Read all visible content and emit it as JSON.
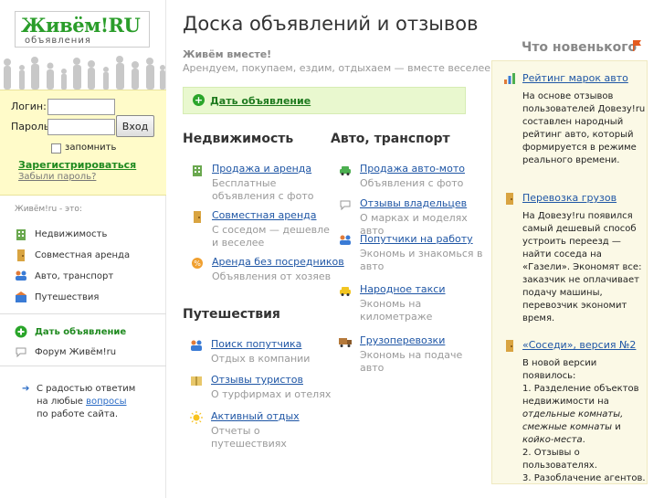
{
  "logo": {
    "main": "Живём!",
    "ru": "RU",
    "sub": "объявления"
  },
  "login": {
    "login_label": "Логин:",
    "password_label": "Пароль:",
    "enter_button": "Вход",
    "remember_label": "запомнить",
    "register_link": "Зарегистрироваться",
    "forgot_link": "Забыли пароль?"
  },
  "about": {
    "title": "Живём!ru - это:",
    "items": [
      {
        "label": "Недвижимость",
        "icon": "building-icon"
      },
      {
        "label": "Совместная аренда",
        "icon": "door-icon"
      },
      {
        "label": "Авто, транспорт",
        "icon": "people-car-icon"
      },
      {
        "label": "Путешествия",
        "icon": "travel-icon"
      }
    ],
    "post_label": "Дать объявление",
    "forum_label": "Форум Живём!ru"
  },
  "help": {
    "line1": "С радостью ответим",
    "line2_pre": "на любые ",
    "line2_link": "вопросы",
    "line3": "по работе сайта."
  },
  "main": {
    "title": "Доска объявлений и отзывов",
    "tagline1": "Живём вместе!",
    "tagline2": "Арендуем, покупаем, ездим, отдыхаем — вместе веселее!",
    "post_button": "Дать объявление"
  },
  "sections": {
    "realty": {
      "title": "Недвижимость",
      "entries": [
        {
          "link": "Продажа и аренда",
          "desc": "Бесплатные объявления с фото"
        },
        {
          "link": "Совместная аренда",
          "desc": "С соседом — дешевле и веселее"
        },
        {
          "link": "Аренда без посредников",
          "desc": "Объявления от хозяев"
        }
      ]
    },
    "auto": {
      "title": "Авто, транспорт",
      "entries": [
        {
          "link": "Продажа авто-мото",
          "desc": "Объявления с фото"
        },
        {
          "link": "Отзывы владельцев",
          "desc": "О марках и моделях авто"
        },
        {
          "link": "Попутчики на работу",
          "desc": "Экономь и знакомься в авто"
        },
        {
          "link": "Народное такси",
          "desc": "Экономь на километраже"
        },
        {
          "link": "Грузоперевозки",
          "desc": "Экономь на подаче авто"
        }
      ]
    },
    "travel": {
      "title": "Путешествия",
      "entries": [
        {
          "link": "Поиск попутчика",
          "desc": "Отдых в компании"
        },
        {
          "link": "Отзывы туристов",
          "desc": "О турфирмах и отелях"
        },
        {
          "link": "Активный отдых",
          "desc": "Отчеты о путешествиях"
        }
      ]
    }
  },
  "news": {
    "title": "Что новенького",
    "items": [
      {
        "link": "Рейтинг марок авто",
        "body": "На основе отзывов пользователей Довезу!ru составлен народный рейтинг авто, который формируется в режиме реального времени."
      },
      {
        "link": "Перевозка грузов",
        "body": "На Довезу!ru появился самый дешевый способ устроить переезд — найти соседа на «Газели». Экономят все: заказчик не оплачивает подачу машины, перевозчик экономит время."
      },
      {
        "link": "«Соседи», версия №2",
        "body_intro": "В новой версии появилось:",
        "body_1a": "1. Разделение объектов недвижимости на ",
        "body_1b": "отдельные комнаты, смежные комнаты",
        "body_1c": " и ",
        "body_1d": "койко-места",
        "body_1e": ".",
        "body_2": "2. Отзывы о пользователях.",
        "body_3": "3. Разоблачение агентов."
      }
    ]
  },
  "colors": {
    "green": "#1f8a1f",
    "link": "#1f56a5",
    "yellow_bg": "#fffbc9",
    "post_bg": "#e9f8cf",
    "news_bg": "#fbf9e6"
  }
}
